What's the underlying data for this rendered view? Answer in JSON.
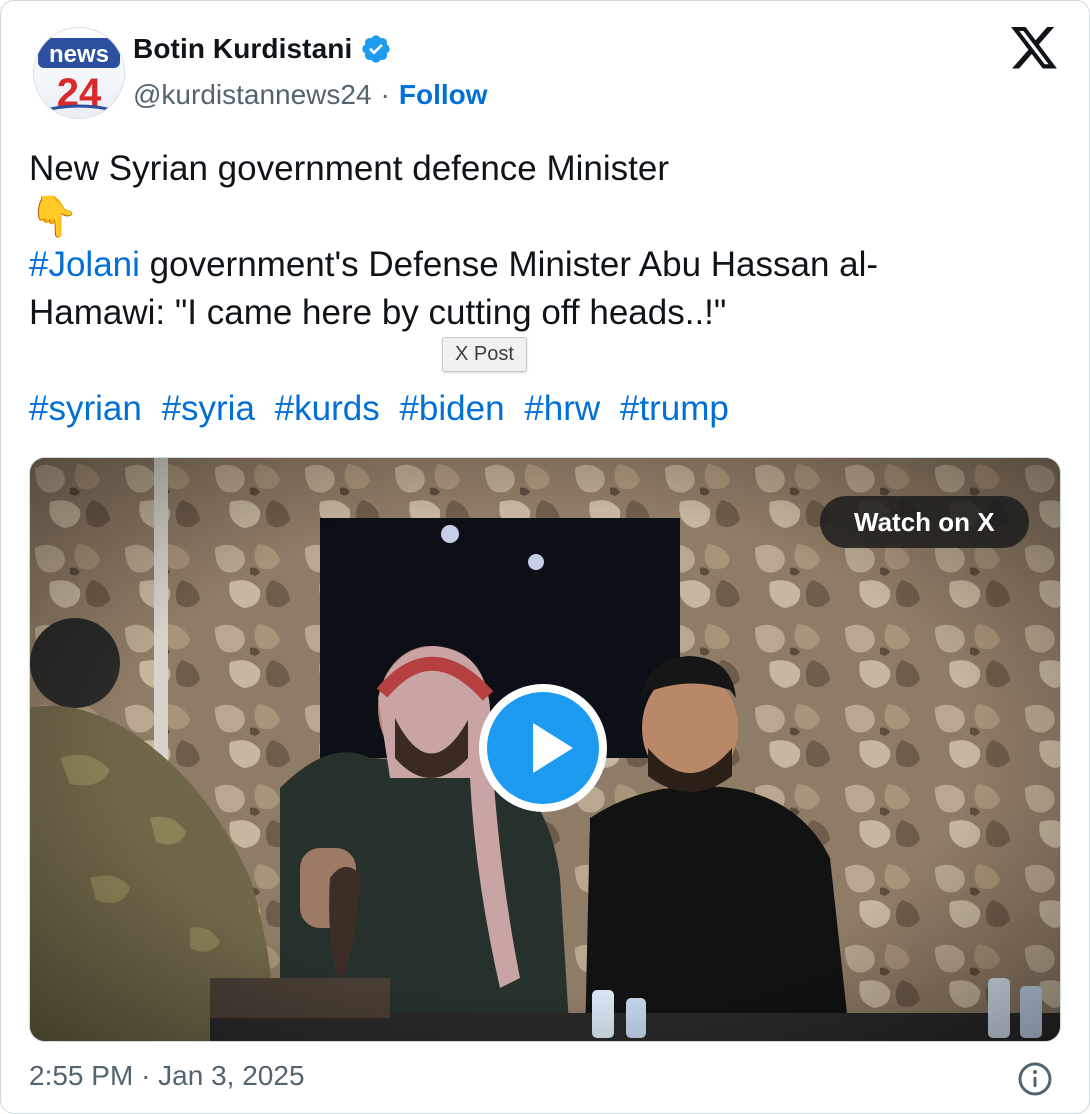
{
  "author": {
    "display_name": "Botin Kurdistani",
    "handle": "@kurdistannews24",
    "separator": "·",
    "follow_label": "Follow",
    "avatar_text_top": "news",
    "avatar_text_bottom": "24"
  },
  "post": {
    "line1": "New Syrian government defence Minister",
    "emoji": "👇",
    "hashtag_jolani": "#Jolani",
    "line2_rest": " government's Defense Minister Abu Hassan al-",
    "line3": "Hamawi: \"I came here by cutting off heads..!\"",
    "hashtags": [
      "#syrian",
      "#syria",
      "#kurds",
      "#biden",
      "#hrw",
      "#trump"
    ]
  },
  "tooltip": "X Post",
  "media": {
    "watch_label": "Watch on X"
  },
  "footer": {
    "time": "2:55 PM",
    "separator": "·",
    "date": "Jan 3, 2025"
  },
  "icons": {
    "verified": "verified-badge-icon",
    "x_logo": "x-logo-icon",
    "play": "play-icon",
    "info": "info-icon"
  },
  "colors": {
    "link": "#006fd6",
    "verified": "#1d9bf0",
    "muted": "#536471",
    "text": "#0f1419"
  }
}
